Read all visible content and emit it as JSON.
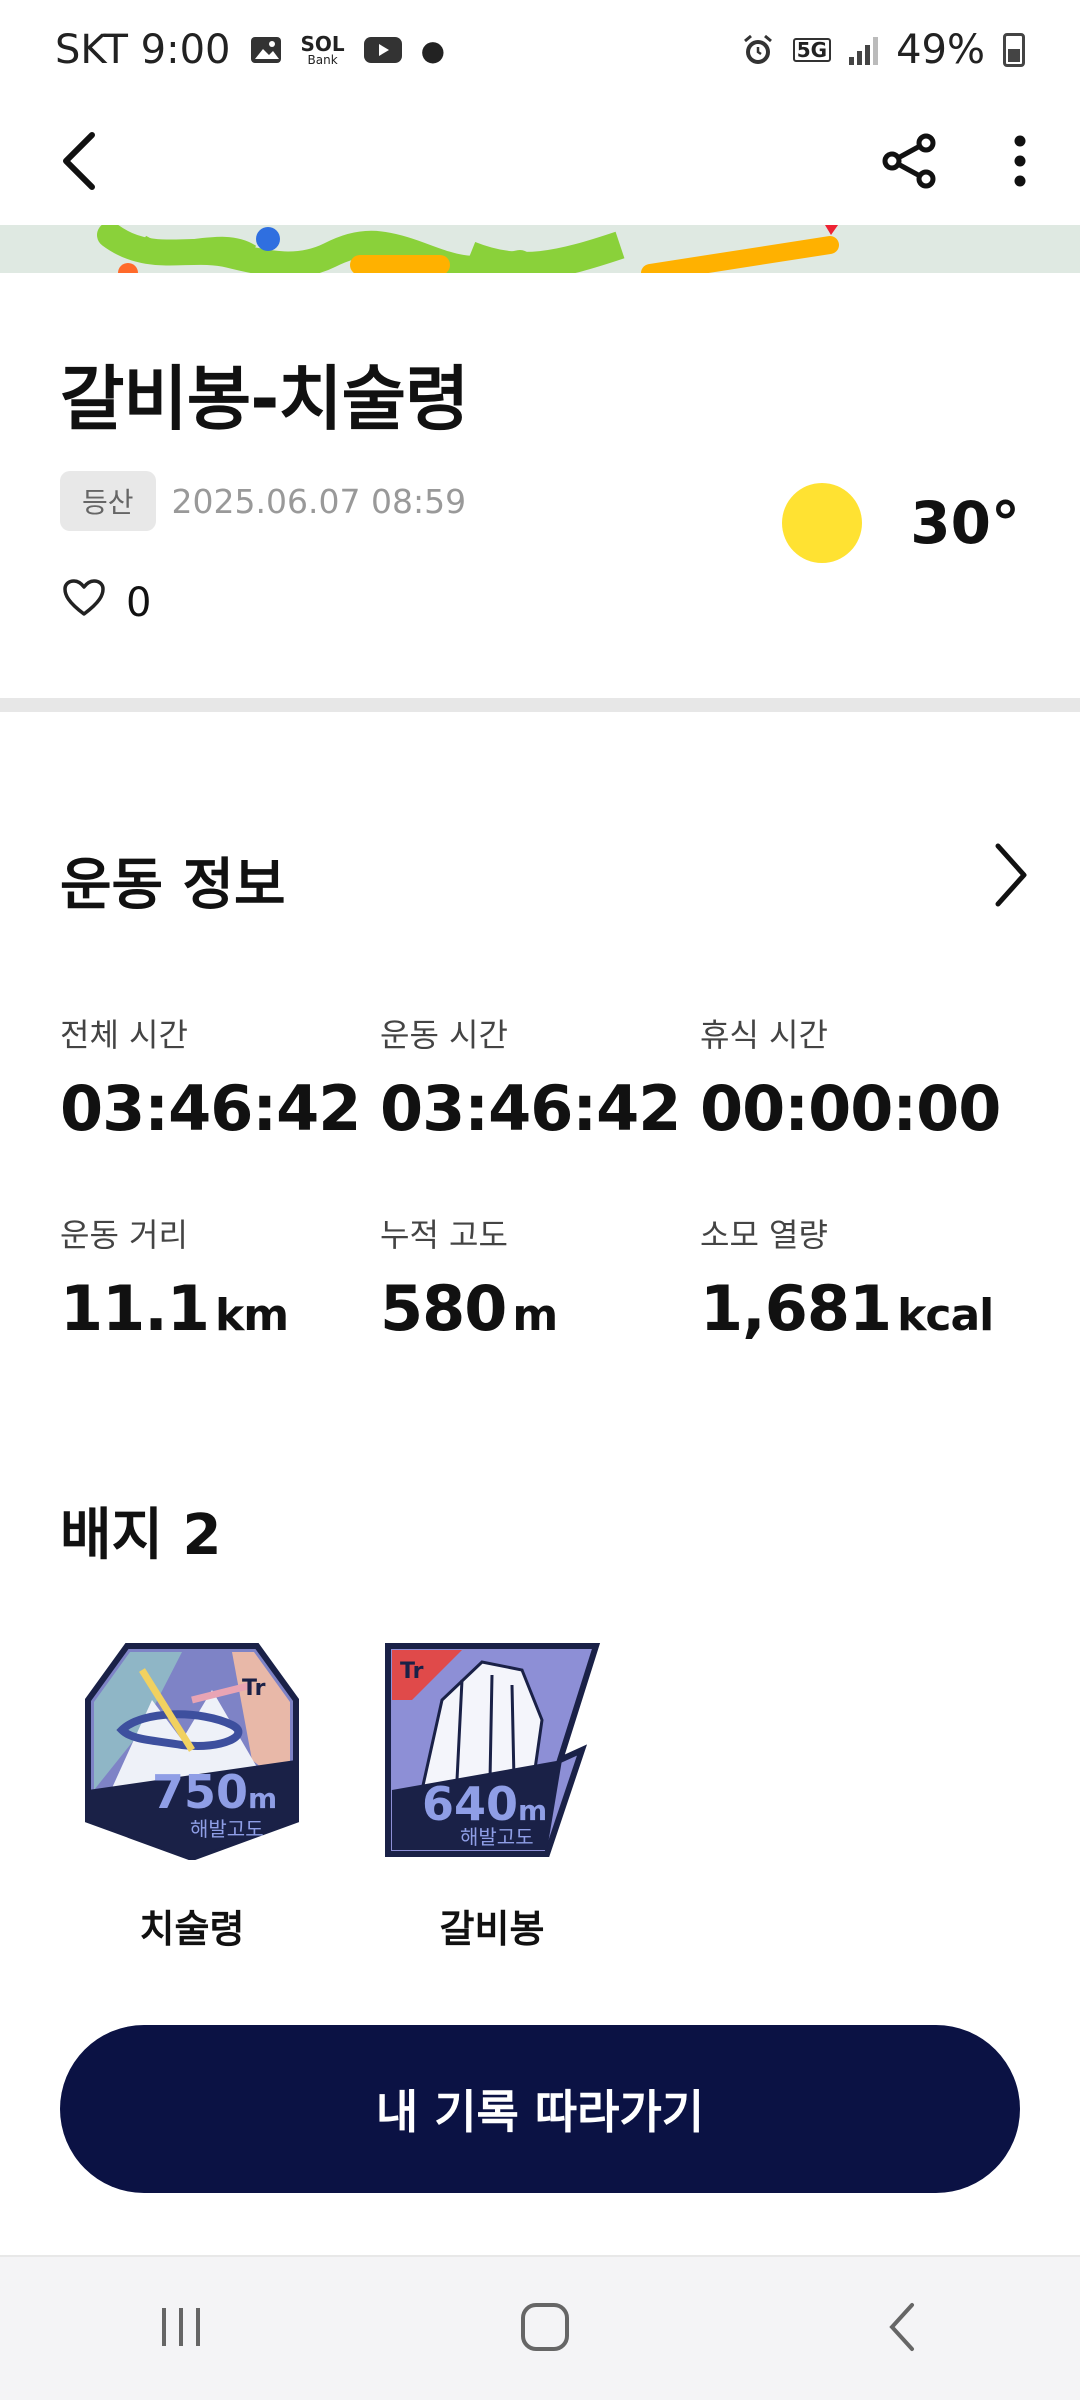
{
  "status_bar": {
    "carrier_time": "SKT 9:00",
    "sol_label": "SOL",
    "bank_label": "Bank",
    "network": "5G",
    "battery": "49%"
  },
  "app_bar": {
    "back_icon": "chevron-left-icon",
    "share_icon": "share-icon",
    "more_icon": "more-vertical-icon"
  },
  "record": {
    "title": "갈비봉-치술령",
    "tag": "등산",
    "datetime": "2025.06.07 08:59",
    "likes": "0",
    "temperature": "30°"
  },
  "exercise": {
    "heading": "운동 정보",
    "stats": [
      {
        "label": "전체 시간",
        "value": "03:46:42",
        "unit": ""
      },
      {
        "label": "운동 시간",
        "value": "03:46:42",
        "unit": ""
      },
      {
        "label": "휴식 시간",
        "value": "00:00:00",
        "unit": ""
      },
      {
        "label": "운동 거리",
        "value": "11.1",
        "unit": "km"
      },
      {
        "label": "누적 고도",
        "value": "580",
        "unit": "m"
      },
      {
        "label": "소모 열량",
        "value": "1,681",
        "unit": "kcal"
      }
    ]
  },
  "badges": {
    "heading": "배지 2",
    "items": [
      {
        "label": "치술령",
        "altitude": "750",
        "unit": "m",
        "caption": "해발고도",
        "logo": "Tr"
      },
      {
        "label": "갈비봉",
        "altitude": "640",
        "unit": "m",
        "caption": "해발고도",
        "logo": "Tr"
      }
    ]
  },
  "cta": {
    "label": "내 기록 따라가기"
  },
  "colors": {
    "cta_bg": "#0b1244",
    "sun": "#ffe232",
    "map_green": "#8ad13a",
    "map_orange": "#ffb100"
  }
}
